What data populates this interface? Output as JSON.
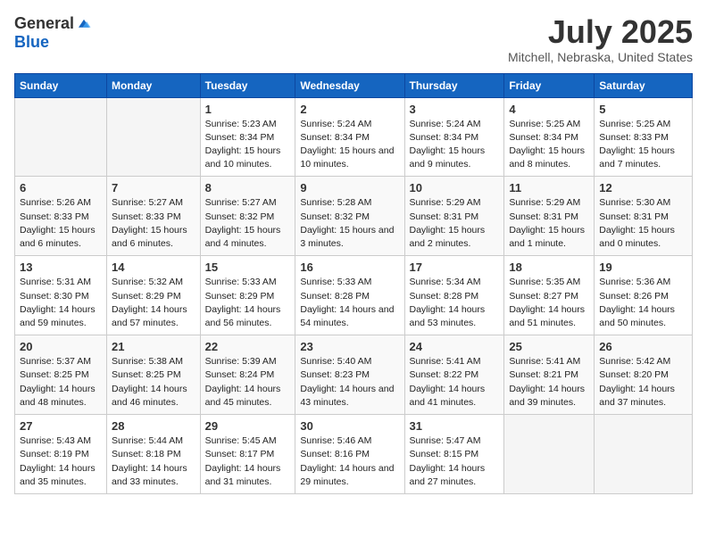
{
  "header": {
    "logo_general": "General",
    "logo_blue": "Blue",
    "title": "July 2025",
    "subtitle": "Mitchell, Nebraska, United States"
  },
  "days_of_week": [
    "Sunday",
    "Monday",
    "Tuesday",
    "Wednesday",
    "Thursday",
    "Friday",
    "Saturday"
  ],
  "weeks": [
    [
      {
        "day": "",
        "info": ""
      },
      {
        "day": "",
        "info": ""
      },
      {
        "day": "1",
        "info": "Sunrise: 5:23 AM\nSunset: 8:34 PM\nDaylight: 15 hours and 10 minutes."
      },
      {
        "day": "2",
        "info": "Sunrise: 5:24 AM\nSunset: 8:34 PM\nDaylight: 15 hours and 10 minutes."
      },
      {
        "day": "3",
        "info": "Sunrise: 5:24 AM\nSunset: 8:34 PM\nDaylight: 15 hours and 9 minutes."
      },
      {
        "day": "4",
        "info": "Sunrise: 5:25 AM\nSunset: 8:34 PM\nDaylight: 15 hours and 8 minutes."
      },
      {
        "day": "5",
        "info": "Sunrise: 5:25 AM\nSunset: 8:33 PM\nDaylight: 15 hours and 7 minutes."
      }
    ],
    [
      {
        "day": "6",
        "info": "Sunrise: 5:26 AM\nSunset: 8:33 PM\nDaylight: 15 hours and 6 minutes."
      },
      {
        "day": "7",
        "info": "Sunrise: 5:27 AM\nSunset: 8:33 PM\nDaylight: 15 hours and 6 minutes."
      },
      {
        "day": "8",
        "info": "Sunrise: 5:27 AM\nSunset: 8:32 PM\nDaylight: 15 hours and 4 minutes."
      },
      {
        "day": "9",
        "info": "Sunrise: 5:28 AM\nSunset: 8:32 PM\nDaylight: 15 hours and 3 minutes."
      },
      {
        "day": "10",
        "info": "Sunrise: 5:29 AM\nSunset: 8:31 PM\nDaylight: 15 hours and 2 minutes."
      },
      {
        "day": "11",
        "info": "Sunrise: 5:29 AM\nSunset: 8:31 PM\nDaylight: 15 hours and 1 minute."
      },
      {
        "day": "12",
        "info": "Sunrise: 5:30 AM\nSunset: 8:31 PM\nDaylight: 15 hours and 0 minutes."
      }
    ],
    [
      {
        "day": "13",
        "info": "Sunrise: 5:31 AM\nSunset: 8:30 PM\nDaylight: 14 hours and 59 minutes."
      },
      {
        "day": "14",
        "info": "Sunrise: 5:32 AM\nSunset: 8:29 PM\nDaylight: 14 hours and 57 minutes."
      },
      {
        "day": "15",
        "info": "Sunrise: 5:33 AM\nSunset: 8:29 PM\nDaylight: 14 hours and 56 minutes."
      },
      {
        "day": "16",
        "info": "Sunrise: 5:33 AM\nSunset: 8:28 PM\nDaylight: 14 hours and 54 minutes."
      },
      {
        "day": "17",
        "info": "Sunrise: 5:34 AM\nSunset: 8:28 PM\nDaylight: 14 hours and 53 minutes."
      },
      {
        "day": "18",
        "info": "Sunrise: 5:35 AM\nSunset: 8:27 PM\nDaylight: 14 hours and 51 minutes."
      },
      {
        "day": "19",
        "info": "Sunrise: 5:36 AM\nSunset: 8:26 PM\nDaylight: 14 hours and 50 minutes."
      }
    ],
    [
      {
        "day": "20",
        "info": "Sunrise: 5:37 AM\nSunset: 8:25 PM\nDaylight: 14 hours and 48 minutes."
      },
      {
        "day": "21",
        "info": "Sunrise: 5:38 AM\nSunset: 8:25 PM\nDaylight: 14 hours and 46 minutes."
      },
      {
        "day": "22",
        "info": "Sunrise: 5:39 AM\nSunset: 8:24 PM\nDaylight: 14 hours and 45 minutes."
      },
      {
        "day": "23",
        "info": "Sunrise: 5:40 AM\nSunset: 8:23 PM\nDaylight: 14 hours and 43 minutes."
      },
      {
        "day": "24",
        "info": "Sunrise: 5:41 AM\nSunset: 8:22 PM\nDaylight: 14 hours and 41 minutes."
      },
      {
        "day": "25",
        "info": "Sunrise: 5:41 AM\nSunset: 8:21 PM\nDaylight: 14 hours and 39 minutes."
      },
      {
        "day": "26",
        "info": "Sunrise: 5:42 AM\nSunset: 8:20 PM\nDaylight: 14 hours and 37 minutes."
      }
    ],
    [
      {
        "day": "27",
        "info": "Sunrise: 5:43 AM\nSunset: 8:19 PM\nDaylight: 14 hours and 35 minutes."
      },
      {
        "day": "28",
        "info": "Sunrise: 5:44 AM\nSunset: 8:18 PM\nDaylight: 14 hours and 33 minutes."
      },
      {
        "day": "29",
        "info": "Sunrise: 5:45 AM\nSunset: 8:17 PM\nDaylight: 14 hours and 31 minutes."
      },
      {
        "day": "30",
        "info": "Sunrise: 5:46 AM\nSunset: 8:16 PM\nDaylight: 14 hours and 29 minutes."
      },
      {
        "day": "31",
        "info": "Sunrise: 5:47 AM\nSunset: 8:15 PM\nDaylight: 14 hours and 27 minutes."
      },
      {
        "day": "",
        "info": ""
      },
      {
        "day": "",
        "info": ""
      }
    ]
  ]
}
